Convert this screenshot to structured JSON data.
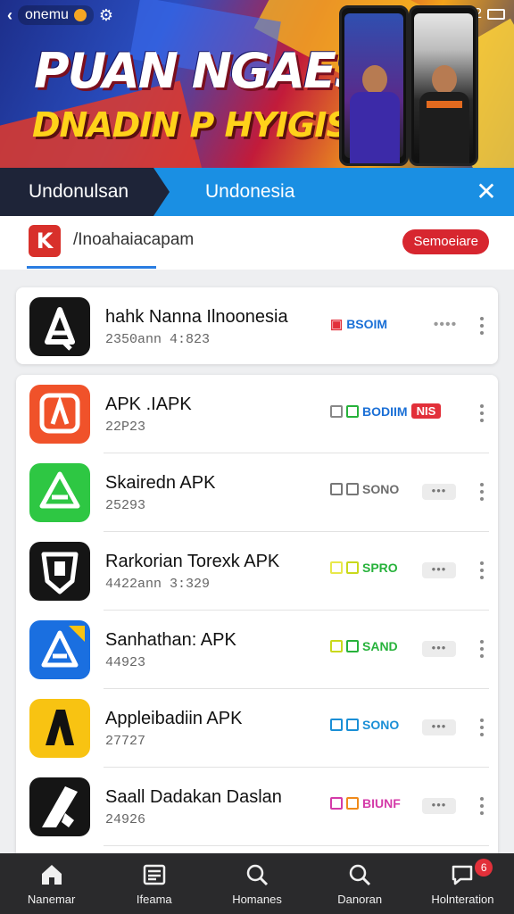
{
  "status_bar": {
    "left_text": "onemu",
    "right_text": "12"
  },
  "banner": {
    "title": "PUAN NGAES!",
    "subtitle": "DNADIN P HYIGISIO"
  },
  "tabs": {
    "active_label": "Undonulsan",
    "inactive_label": "Undonesia",
    "close_icon": "close-icon"
  },
  "app_header": {
    "logo_glyph": "K",
    "name": "/Inoahaiacapam",
    "button_label": "Semoeiare"
  },
  "featured": {
    "title": "hahk Nanna Ilnoonesia",
    "subtitle": "2350ann 4:823",
    "tag_label": "BSOIM",
    "tag_color": "#1a6fd6",
    "dots": "••••"
  },
  "apps": [
    {
      "title": "APK .IAPK",
      "subtitle": "22P23",
      "tag_label": "BODIIM",
      "tag_color": "#1a6fd6",
      "extra_tag": "NIS",
      "icon_bg": "#f0522a",
      "icon": "android-store-icon"
    },
    {
      "title": "Skairedn APK",
      "subtitle": "25293",
      "tag_label": "SONO",
      "tag_color": "#6d6d6d",
      "extra_tag": "",
      "icon_bg": "#2ec743",
      "icon": "android-store-icon"
    },
    {
      "title": "Rarkorian Torexk APK",
      "subtitle": "4422ann 3:329",
      "tag_label": "SPRO",
      "tag_color": "#27b23b",
      "extra_tag": "",
      "icon_bg": "#151515",
      "icon": "shield-store-icon"
    },
    {
      "title": "Sanhathan: APK",
      "subtitle": "44923",
      "tag_label": "SAND",
      "tag_color": "#27b23b",
      "extra_tag": "",
      "icon_bg": "#1a6fe0",
      "icon": "android-store-icon"
    },
    {
      "title": "Appleibadiin APK",
      "subtitle": "27727",
      "tag_label": "SONO",
      "tag_color": "#1a8fd6",
      "extra_tag": "",
      "icon_bg": "#f8c312",
      "icon": "bolt-store-icon"
    },
    {
      "title": "Saall Dadakan Daslan",
      "subtitle": "24926",
      "tag_label": "BIUNF",
      "tag_color": "#d43aa8",
      "extra_tag": "",
      "icon_bg": "#151515",
      "icon": "feather-store-icon"
    }
  ],
  "row_dots": "•••",
  "bottom_nav": [
    {
      "label": "Nanemar",
      "icon": "home-icon"
    },
    {
      "label": "Ifeama",
      "icon": "news-icon"
    },
    {
      "label": "Homanes",
      "icon": "search-icon"
    },
    {
      "label": "Danoran",
      "icon": "search-icon"
    },
    {
      "label": "Holnteration",
      "icon": "chat-icon",
      "badge": "6"
    }
  ],
  "colors": {
    "accent_blue": "#1a8fe3",
    "tab_dark": "#1e2438",
    "red": "#d7262f",
    "nav_bg": "#2a2a2c"
  }
}
